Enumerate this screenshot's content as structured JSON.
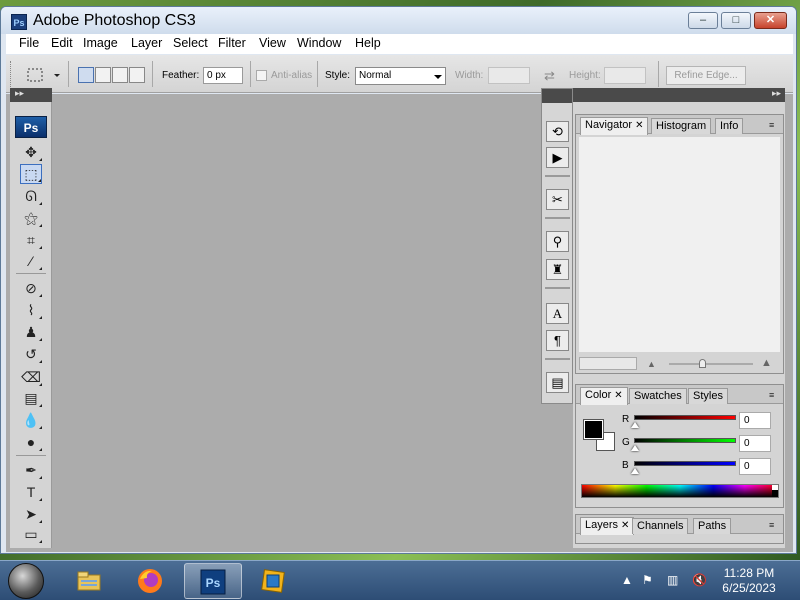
{
  "window": {
    "title": "Adobe Photoshop CS3",
    "icon_label": "Ps"
  },
  "title_buttons": {
    "minimize": "–",
    "maximize": "□",
    "close": "✕"
  },
  "menu": [
    "File",
    "Edit",
    "Image",
    "Layer",
    "Select",
    "Filter",
    "View",
    "Window",
    "Help"
  ],
  "options": {
    "feather_label": "Feather:",
    "feather_value": "0 px",
    "antialias_label": "Anti-alias",
    "style_label": "Style:",
    "style_value": "Normal",
    "width_label": "Width:",
    "height_label": "Height:",
    "swap_icon": "⇄",
    "refine_edge": "Refine Edge..."
  },
  "toolbox": {
    "logo": "Ps",
    "tools": [
      {
        "name": "move-tool-icon",
        "glyph": "✥"
      },
      {
        "name": "rectangular-marquee-tool-icon",
        "glyph": "⬚",
        "selected": true
      },
      {
        "name": "lasso-tool-icon",
        "glyph": "ᘏ"
      },
      {
        "name": "magic-wand-tool-icon",
        "glyph": "⚝"
      },
      {
        "name": "crop-tool-icon",
        "glyph": "⌗"
      },
      {
        "name": "eyedropper-tool-icon",
        "glyph": "⁄"
      },
      {
        "name": "healing-brush-tool-icon",
        "glyph": "⊘"
      },
      {
        "name": "brush-tool-icon",
        "glyph": "⌇"
      },
      {
        "name": "clone-stamp-tool-icon",
        "glyph": "♟"
      },
      {
        "name": "history-brush-tool-icon",
        "glyph": "↺"
      },
      {
        "name": "eraser-tool-icon",
        "glyph": "⌫"
      },
      {
        "name": "gradient-tool-icon",
        "glyph": "▤"
      },
      {
        "name": "blur-tool-icon",
        "glyph": "💧"
      },
      {
        "name": "dodge-tool-icon",
        "glyph": "●"
      },
      {
        "name": "pen-tool-icon",
        "glyph": "✒"
      },
      {
        "name": "type-tool-icon",
        "glyph": "T"
      },
      {
        "name": "path-selection-tool-icon",
        "glyph": "➤"
      },
      {
        "name": "shape-tool-icon",
        "glyph": "▭"
      }
    ]
  },
  "dock_icons": [
    "history-icon",
    "actions-icon",
    "tool-presets-icon",
    "brushes-icon",
    "clone-source-icon",
    "character-icon",
    "paragraph-icon",
    "layer-comps-icon"
  ],
  "panels": {
    "top_tabs": [
      {
        "label": "Navigator",
        "active": true,
        "closable": true
      },
      {
        "label": "Histogram",
        "active": false
      },
      {
        "label": "Info",
        "active": false
      }
    ],
    "color_tabs": [
      {
        "label": "Color",
        "active": true,
        "closable": true
      },
      {
        "label": "Swatches",
        "active": false
      },
      {
        "label": "Styles",
        "active": false
      }
    ],
    "layer_tabs": [
      {
        "label": "Layers",
        "active": true,
        "closable": true
      },
      {
        "label": "Channels",
        "active": false
      },
      {
        "label": "Paths",
        "active": false
      }
    ],
    "color": {
      "foreground": "#000000",
      "background": "#ffffff",
      "channels": [
        {
          "label": "R",
          "value": "0",
          "color": "#cc1111"
        },
        {
          "label": "G",
          "value": "0",
          "color": "#22aa22"
        },
        {
          "label": "B",
          "value": "0",
          "color": "#1a1acc"
        }
      ]
    }
  },
  "taskbar": {
    "clock_time": "11:28 PM",
    "clock_date": "6/25/2023",
    "apps": [
      "file-explorer-icon",
      "firefox-icon",
      "photoshop-icon",
      "virtualbox-icon"
    ],
    "active_app": "photoshop-icon",
    "tray_icons": [
      "show-hidden-icons-icon",
      "action-center-flag-icon",
      "network-icon",
      "volume-muted-icon"
    ]
  }
}
